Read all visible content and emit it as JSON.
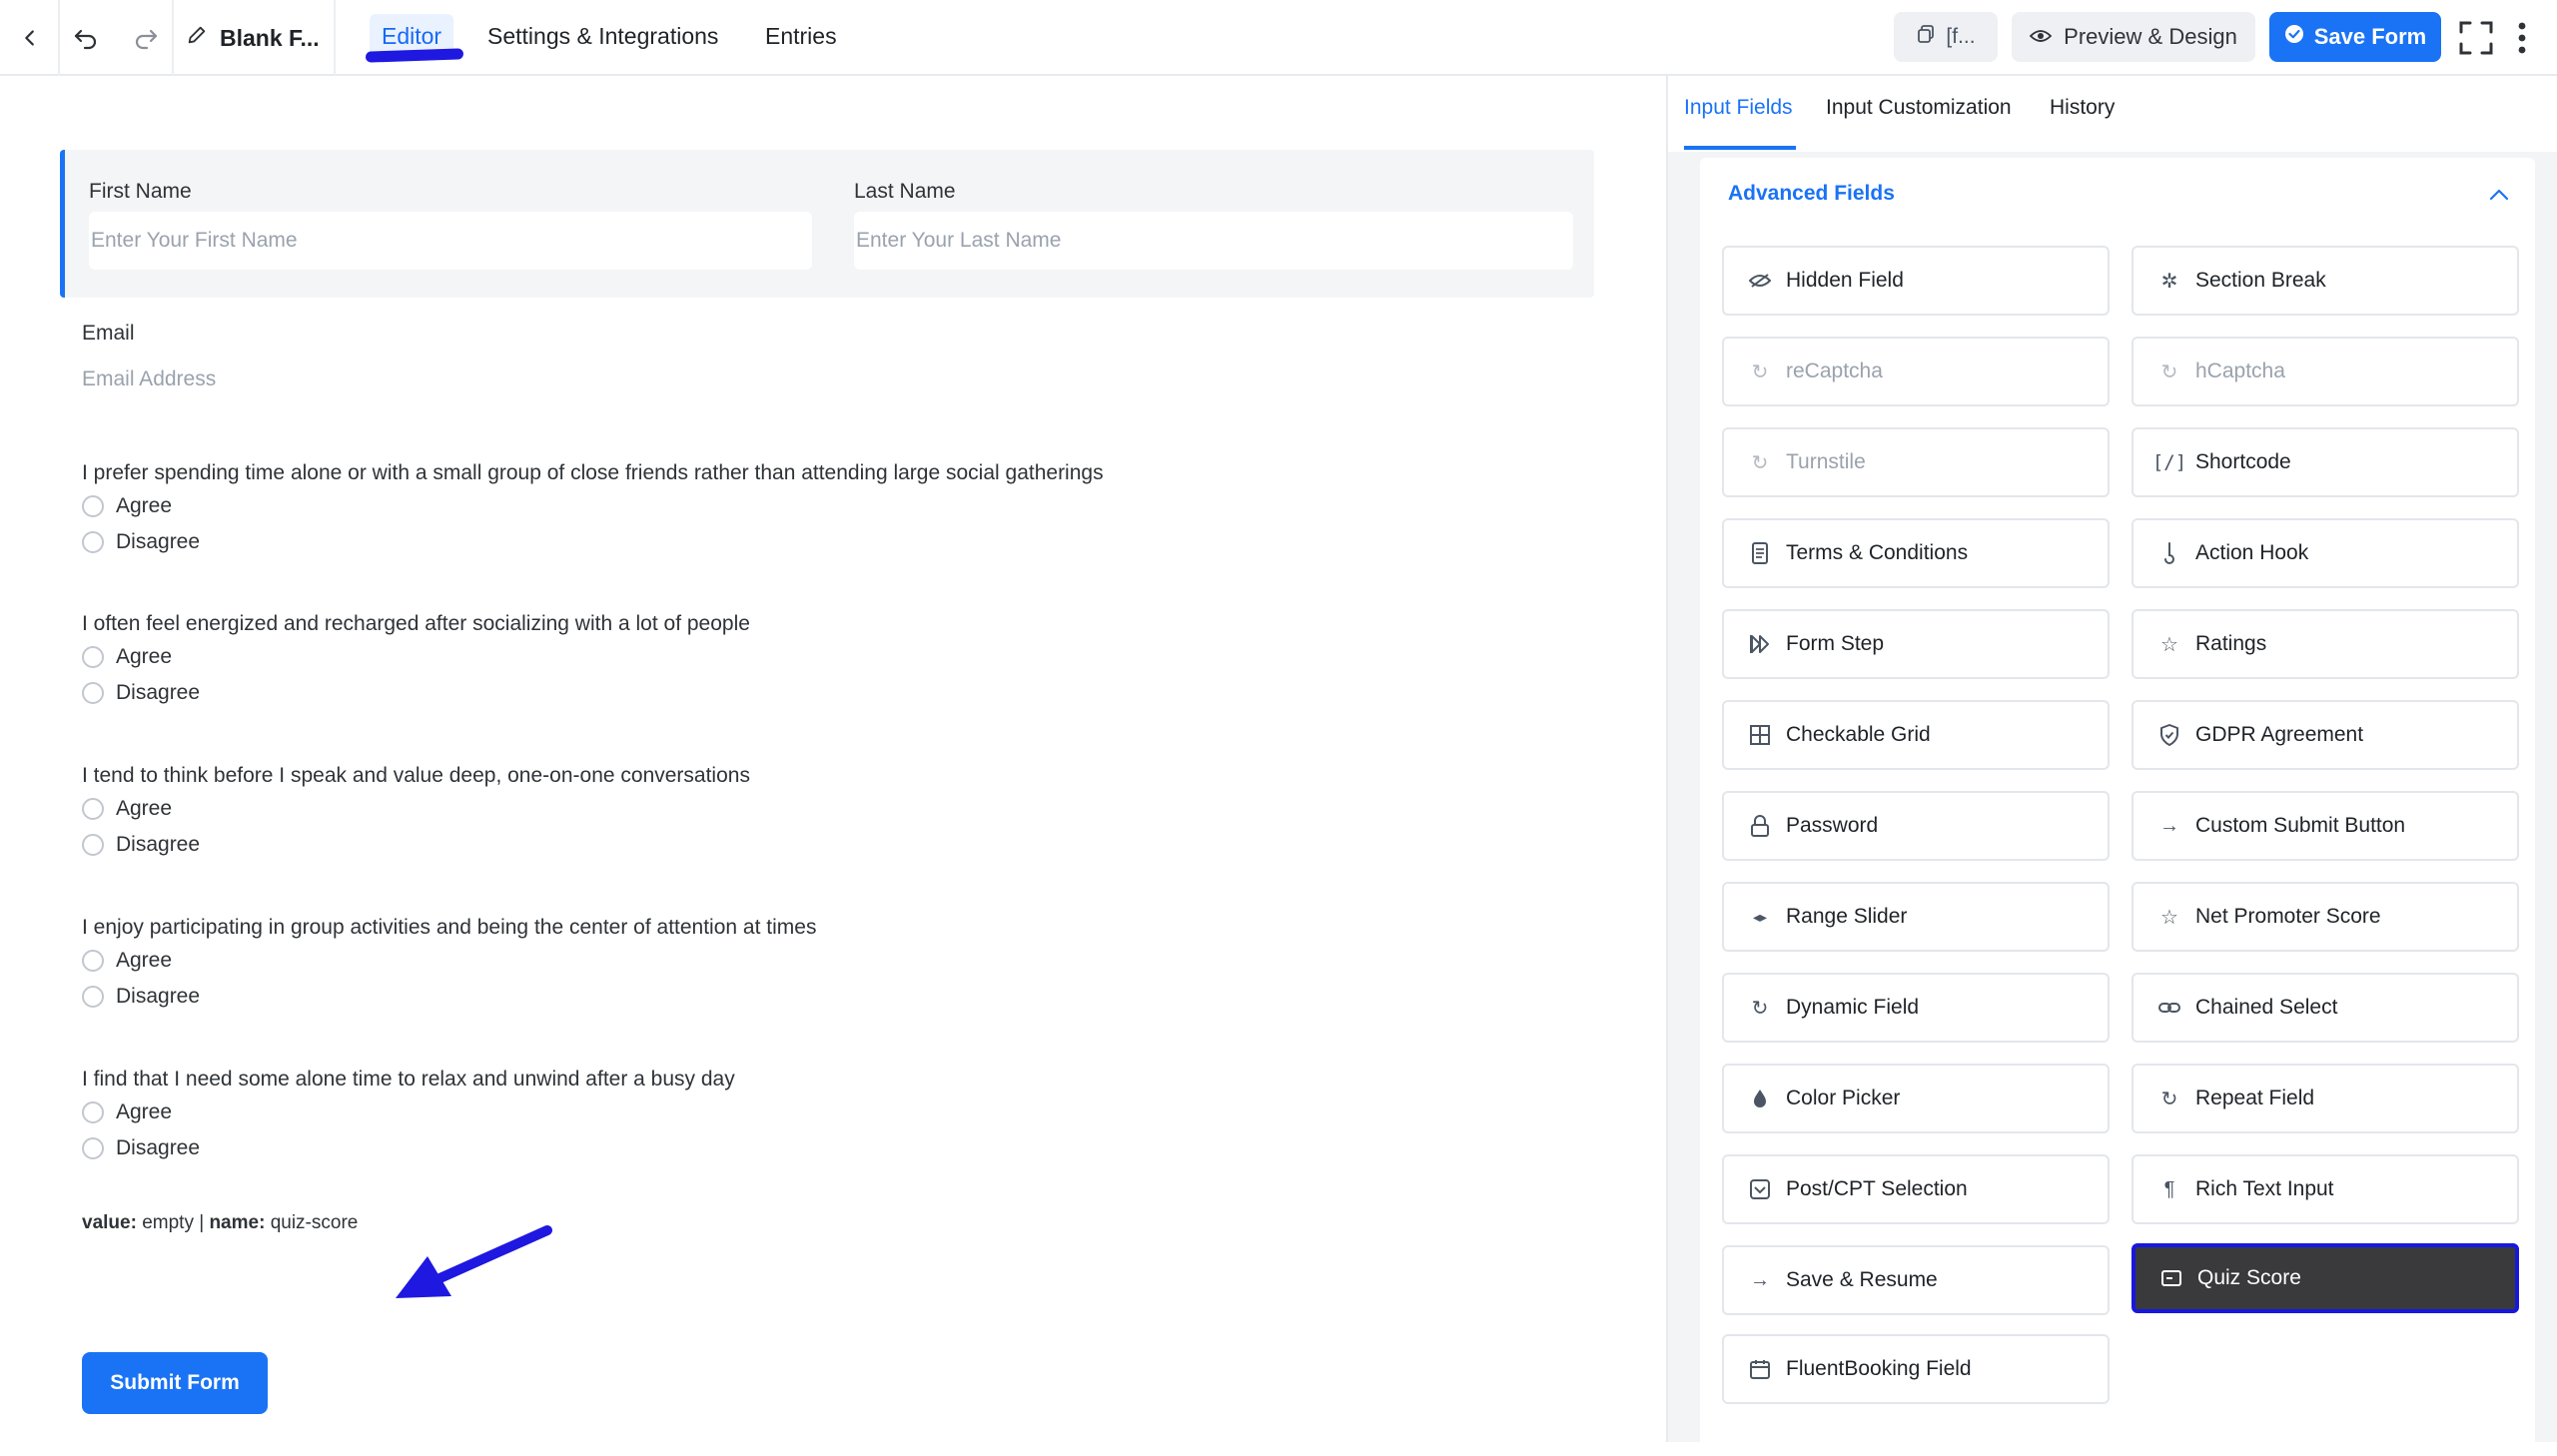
{
  "topbar": {
    "form_title": "Blank F...",
    "tabs": [
      "Editor",
      "Settings & Integrations",
      "Entries"
    ],
    "shortcode_label": "[f...",
    "preview_label": "Preview & Design",
    "save_label": "Save Form"
  },
  "form": {
    "first_name_label": "First Name",
    "first_name_placeholder": "Enter Your First Name",
    "last_name_label": "Last Name",
    "last_name_placeholder": "Enter Your Last Name",
    "email_label": "Email",
    "email_placeholder": "Email Address",
    "questions": [
      {
        "text": "I prefer spending time alone or with a small group of close friends rather than attending large social gatherings",
        "options": [
          "Agree",
          "Disagree"
        ]
      },
      {
        "text": "I often feel energized and recharged after socializing with a lot of people",
        "options": [
          "Agree",
          "Disagree"
        ]
      },
      {
        "text": "I tend to think before I speak and value deep, one-on-one conversations",
        "options": [
          "Agree",
          "Disagree"
        ]
      },
      {
        "text": "I enjoy participating in group activities and being the center of attention at times",
        "options": [
          "Agree",
          "Disagree"
        ]
      },
      {
        "text": "I find that I need some alone time to relax and unwind after a busy day",
        "options": [
          "Agree",
          "Disagree"
        ]
      }
    ],
    "quiz_score": {
      "value_key": "value:",
      "value": "empty",
      "separator": "|",
      "name_key": "name:",
      "name": "quiz-score"
    },
    "submit_label": "Submit Form"
  },
  "panel": {
    "tabs": [
      "Input Fields",
      "Input Customization",
      "History"
    ],
    "section_title": "Advanced Fields",
    "fields": [
      {
        "label": "Hidden Field",
        "icon": "eye-slash-icon"
      },
      {
        "label": "Section Break",
        "icon": "puzzle-icon"
      },
      {
        "label": "reCaptcha",
        "icon": "recaptcha-icon"
      },
      {
        "label": "hCaptcha",
        "icon": "hcaptcha-icon"
      },
      {
        "label": "Turnstile",
        "icon": "turnstile-icon"
      },
      {
        "label": "Shortcode",
        "icon": "shortcode-icon"
      },
      {
        "label": "Terms & Conditions",
        "icon": "document-icon"
      },
      {
        "label": "Action Hook",
        "icon": "hook-icon"
      },
      {
        "label": "Form Step",
        "icon": "step-forward-icon"
      },
      {
        "label": "Ratings",
        "icon": "star-icon"
      },
      {
        "label": "Checkable Grid",
        "icon": "grid-icon"
      },
      {
        "label": "GDPR Agreement",
        "icon": "shield-icon"
      },
      {
        "label": "Password",
        "icon": "lock-icon"
      },
      {
        "label": "Custom Submit Button",
        "icon": "arrow-right-icon"
      },
      {
        "label": "Range Slider",
        "icon": "range-icon"
      },
      {
        "label": "Net Promoter Score",
        "icon": "star-icon"
      },
      {
        "label": "Dynamic Field",
        "icon": "refresh-icon"
      },
      {
        "label": "Chained Select",
        "icon": "link-icon"
      },
      {
        "label": "Color Picker",
        "icon": "droplet-icon"
      },
      {
        "label": "Repeat Field",
        "icon": "refresh-icon"
      },
      {
        "label": "Post/CPT Selection",
        "icon": "post-icon"
      },
      {
        "label": "Rich Text Input",
        "icon": "paragraph-icon"
      },
      {
        "label": "Save & Resume",
        "icon": "arrow-right-icon"
      },
      {
        "label": "Quiz Score",
        "icon": "quiz-icon"
      },
      {
        "label": "FluentBooking Field",
        "icon": "calendar-icon"
      }
    ]
  }
}
